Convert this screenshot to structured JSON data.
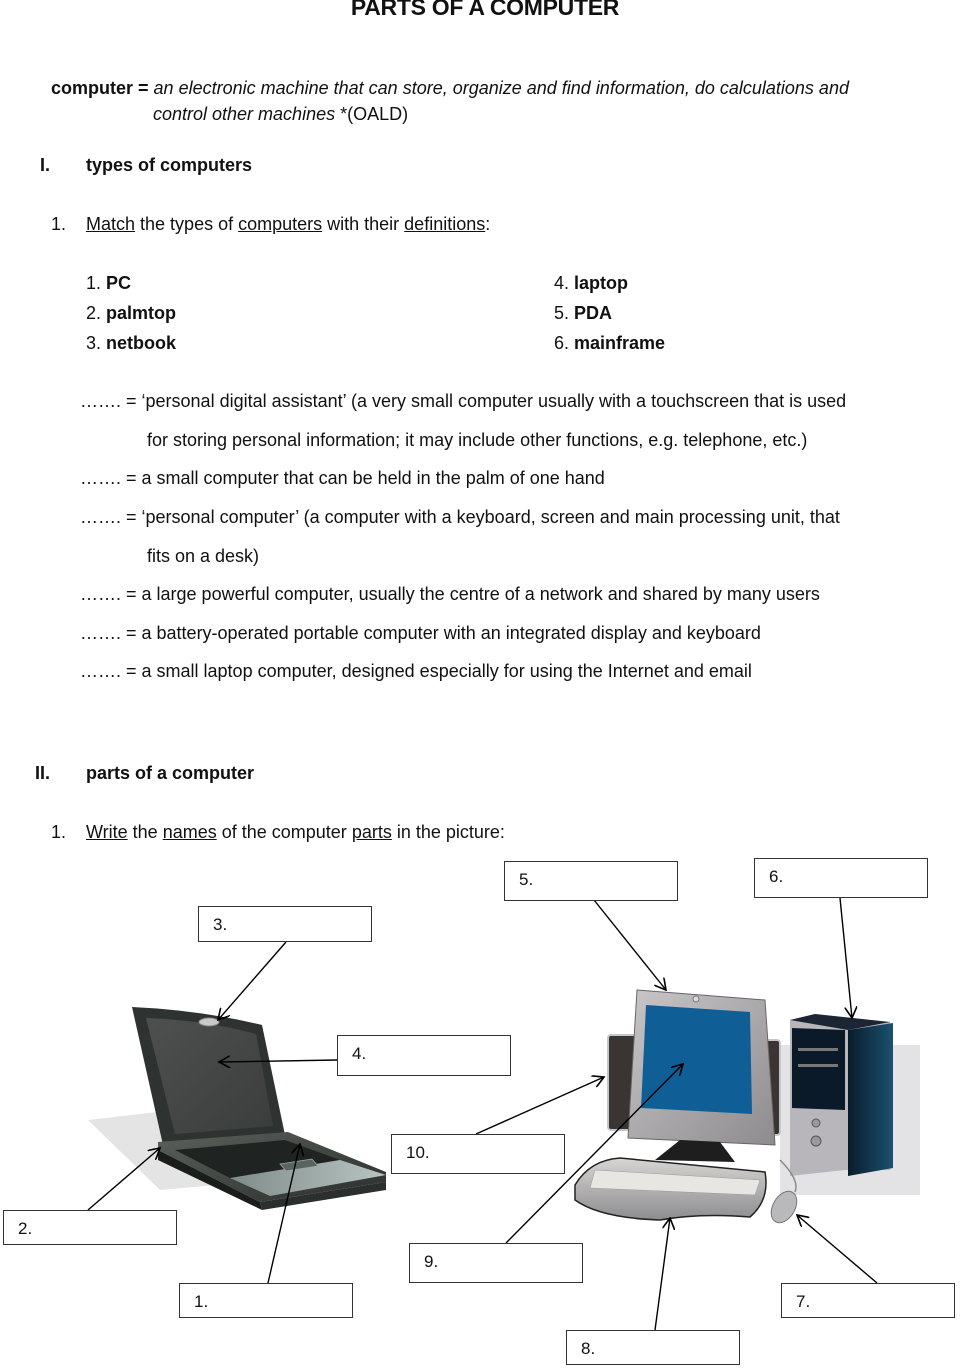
{
  "title": "PARTS OF A COMPUTER",
  "definition": {
    "term": "computer =",
    "text_line1": "an electronic machine that can store, organize and find information, do calculations and",
    "text_line2": "control other machines",
    "source": " *(OALD)"
  },
  "section1": {
    "numeral": "I.",
    "heading": "types of computers",
    "exercise": {
      "number": "1.",
      "parts": [
        {
          "text": "Match",
          "underline": true
        },
        {
          "text": " the types of ",
          "underline": false
        },
        {
          "text": "computers",
          "underline": true
        },
        {
          "text": " with their ",
          "underline": false
        },
        {
          "text": "definitions",
          "underline": true
        },
        {
          "text": ":",
          "underline": false
        }
      ]
    },
    "options_left": [
      {
        "num": "1. ",
        "word": "PC"
      },
      {
        "num": "2. ",
        "word": "palmtop"
      },
      {
        "num": "3. ",
        "word": "netbook"
      }
    ],
    "options_right": [
      {
        "num": "4. ",
        "word": "laptop"
      },
      {
        "num": "5. ",
        "word": "PDA"
      },
      {
        "num": "6. ",
        "word": "mainframe"
      }
    ],
    "definitions": [
      {
        "blank": "……. =",
        "text": "  ‘personal digital assistant’ (a very small computer usually with a touchscreen that is used",
        "continuation": "for storing personal information; it may include other functions, e.g. telephone, etc.)"
      },
      {
        "blank": "……. =",
        "text": " a small computer that can be held in the palm of one hand",
        "continuation": ""
      },
      {
        "blank": "……. =",
        "text": " ‘personal computer’ (a computer with a keyboard, screen and main processing unit, that",
        "continuation": "fits on a desk)"
      },
      {
        "blank": "……. =",
        "text": " a large powerful computer, usually the centre of a network and shared by many users",
        "continuation": ""
      },
      {
        "blank": "……. =",
        "text": " a battery-operated portable computer with an integrated display and keyboard",
        "continuation": ""
      },
      {
        "blank": "……. =",
        "text": "  a small laptop computer, designed especially for using the Internet and email",
        "continuation": ""
      }
    ]
  },
  "section2": {
    "numeral": "II.",
    "heading": "parts of a computer",
    "exercise": {
      "number": "1.",
      "parts": [
        {
          "text": "Write",
          "underline": true
        },
        {
          "text": " the ",
          "underline": false
        },
        {
          "text": "names",
          "underline": true
        },
        {
          "text": " of the computer ",
          "underline": false
        },
        {
          "text": "parts",
          "underline": true
        },
        {
          "text": " in the picture:",
          "underline": false
        }
      ]
    },
    "labels": {
      "l1": "1.",
      "l2": "2.",
      "l3": "3.",
      "l4": "4.",
      "l5": "5.",
      "l6": "6.",
      "l7": "7.",
      "l8": "8.",
      "l9": "9.",
      "l10": "10."
    }
  },
  "colors": {
    "monitor_screen": "#0f5f96",
    "tower_dark": "#0d2a40",
    "laptop_body": "#3d423f"
  }
}
